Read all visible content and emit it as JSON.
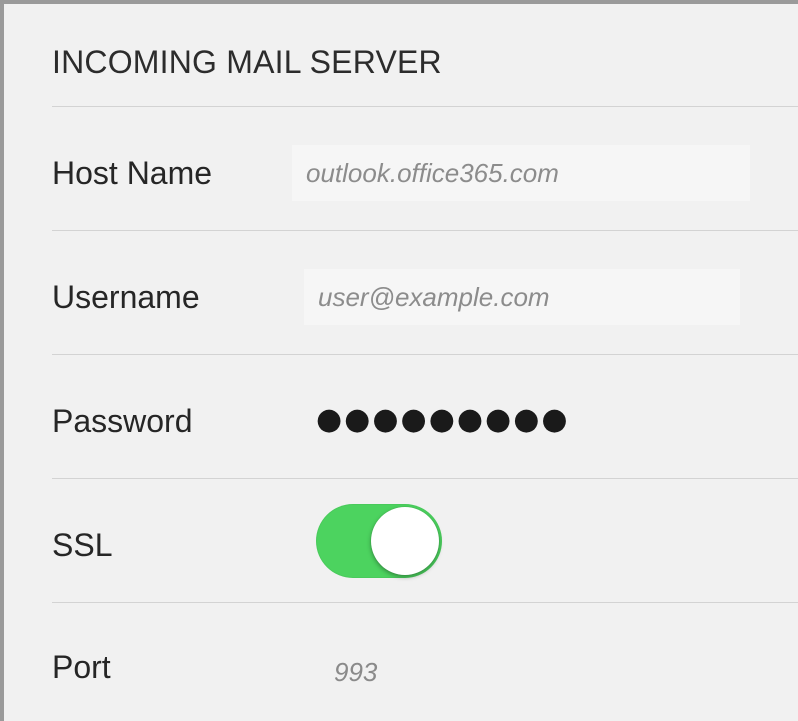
{
  "section": {
    "title": "INCOMING MAIL SERVER"
  },
  "rows": {
    "host_name": {
      "label": "Host Name",
      "value": "outlook.office365.com"
    },
    "username": {
      "label": "Username",
      "value": "user@example.com"
    },
    "password": {
      "label": "Password",
      "value": "●●●●●●●●●"
    },
    "ssl": {
      "label": "SSL",
      "enabled": true,
      "toggle_color": "#4cd35f"
    },
    "port": {
      "label": "Port",
      "value": "993"
    }
  }
}
